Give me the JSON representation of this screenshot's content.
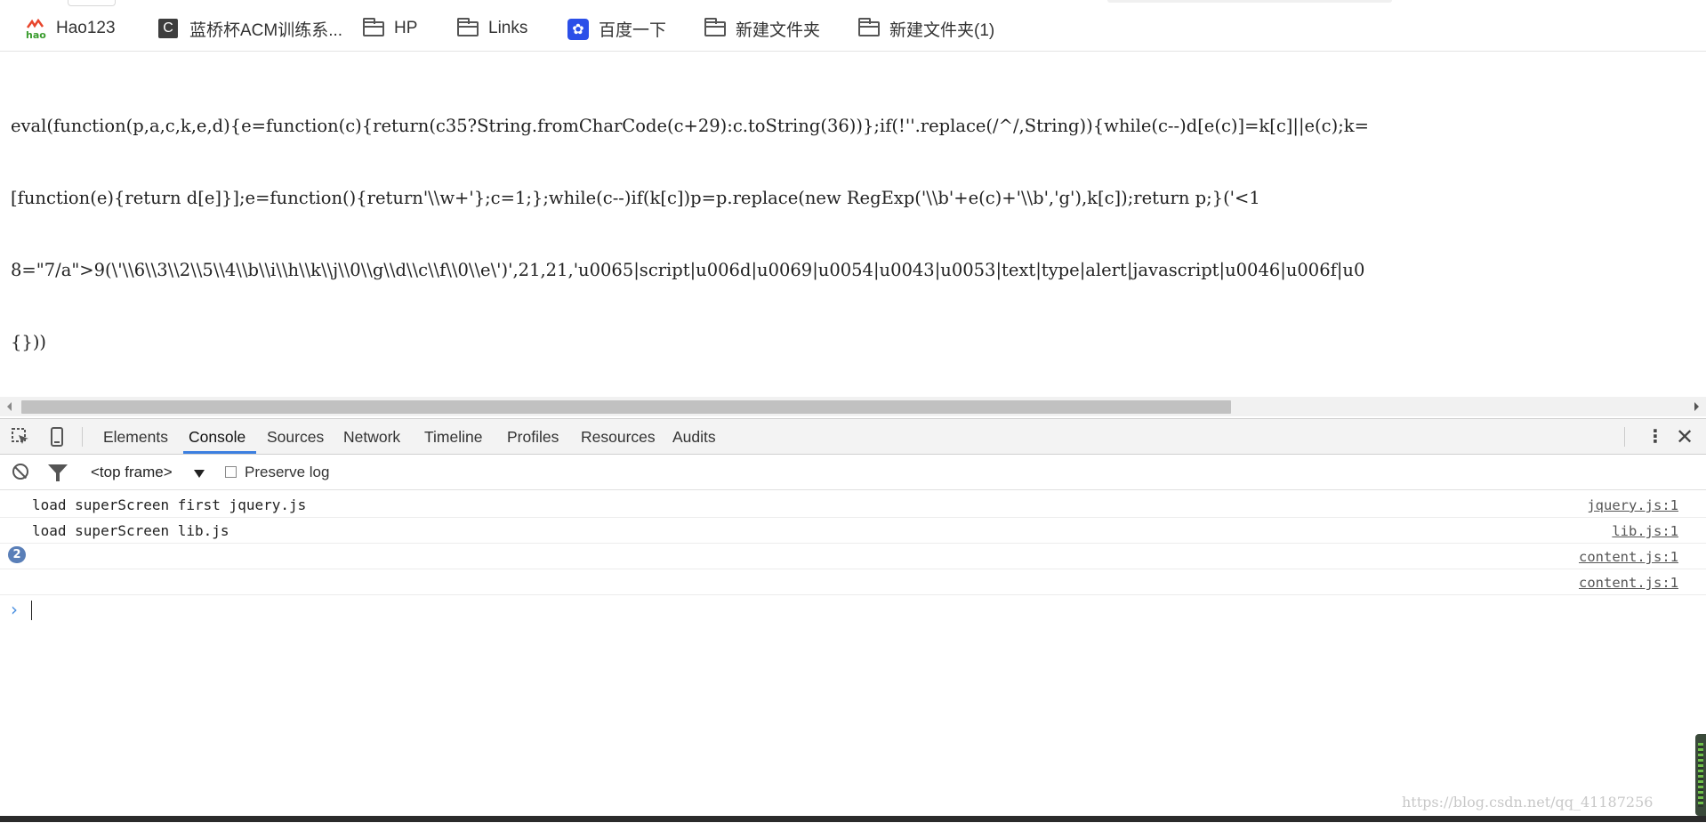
{
  "bookmarks": [
    {
      "label": "Hao123",
      "icon": "hao123-logo-icon"
    },
    {
      "label": "蓝桥杯ACM训练系...",
      "icon": "c-logo-icon"
    },
    {
      "label": "HP",
      "icon": "folder-icon"
    },
    {
      "label": "Links",
      "icon": "folder-icon"
    },
    {
      "label": "百度一下",
      "icon": "baidu-paw-icon"
    },
    {
      "label": "新建文件夹",
      "icon": "folder-icon"
    },
    {
      "label": "新建文件夹(1)",
      "icon": "folder-icon"
    }
  ],
  "page": {
    "code_lines": [
      "eval(function(p,a,c,k,e,d){e=function(c){return(c35?String.fromCharCode(c+29):c.toString(36))};if(!''.replace(/^/,String)){while(c--)d[e(c)]=k[c]||e(c);k=",
      "[function(e){return d[e]}];e=function(){return'\\\\w+'};c=1;};while(c--)if(k[c])p=p.replace(new RegExp('\\\\b'+e(c)+'\\\\b','g'),k[c]);return p;}('<1",
      "8=\"7/a\">9(\\'\\\\6\\\\3\\\\2\\\\5\\\\4\\\\b\\\\i\\\\h\\\\k\\\\j\\\\0\\\\g\\\\d\\\\c\\\\f\\\\0\\\\e\\')',21,21,'u0065|script|u006d|u0069|u0054|u0043|u0053|text|type|alert|javascript|u0046|u006f|u0",
      "{}))"
    ]
  },
  "devtools": {
    "tabs": [
      "Elements",
      "Console",
      "Sources",
      "Network",
      "Timeline",
      "Profiles",
      "Resources",
      "Audits"
    ],
    "active_tab": "Console",
    "context": "<top frame>",
    "preserve_log_label": "Preserve log",
    "preserve_log_checked": false,
    "logs": [
      {
        "message": "load superScreen first jquery.js",
        "source": "jquery.js:1",
        "count": ""
      },
      {
        "message": "load superScreen lib.js",
        "source": "lib.js:1",
        "count": ""
      },
      {
        "message": "",
        "source": "content.js:1",
        "count": "2"
      },
      {
        "message": "",
        "source": "content.js:1",
        "count": ""
      }
    ],
    "prompt_symbol": "›",
    "accent_color": "#3c7fe0"
  },
  "watermark": "https://blog.csdn.net/qq_41187256"
}
